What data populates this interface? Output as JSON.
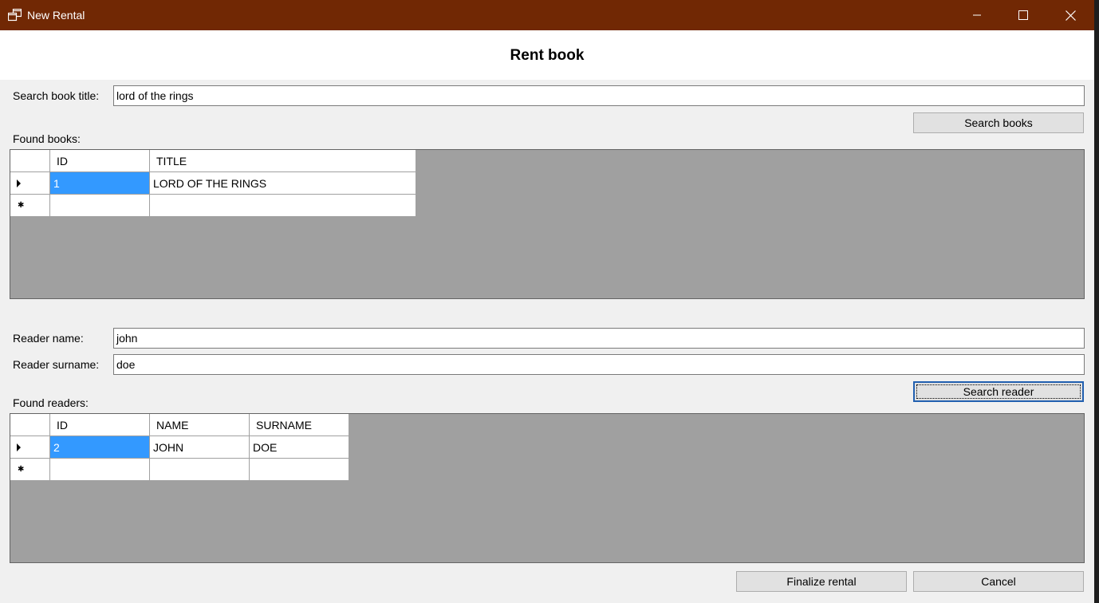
{
  "window": {
    "title": "New Rental",
    "icon": "window-restore-icon",
    "colors": {
      "titlebar": "#712804",
      "selection": "#3399ff",
      "grid_background": "#a0a0a0"
    }
  },
  "header": {
    "title": "Rent book"
  },
  "book_search": {
    "label": "Search book title:",
    "value": "lord of the rings",
    "button_label": "Search books",
    "results_label": "Found books:"
  },
  "books_grid": {
    "columns": [
      "ID",
      "TITLE"
    ],
    "rows": [
      {
        "id": "1",
        "title": "LORD OF THE RINGS"
      }
    ]
  },
  "reader_search": {
    "name_label": "Reader name:",
    "name_value": "john",
    "surname_label": "Reader surname:",
    "surname_value": "doe",
    "button_label": "Search reader",
    "results_label": "Found readers:"
  },
  "readers_grid": {
    "columns": [
      "ID",
      "NAME",
      "SURNAME"
    ],
    "rows": [
      {
        "id": "2",
        "name": "JOHN",
        "surname": "DOE"
      }
    ]
  },
  "footer": {
    "finalize_label": "Finalize rental",
    "cancel_label": "Cancel"
  }
}
